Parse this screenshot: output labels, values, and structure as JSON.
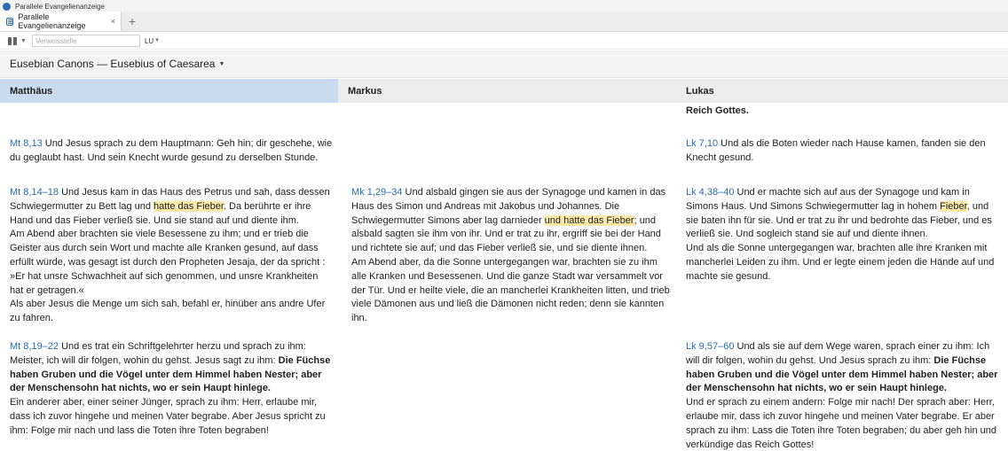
{
  "window": {
    "title": "Parallele Evangelienanzeige"
  },
  "tab": {
    "label": "Parallele Evangelienanzeige",
    "close": "×",
    "add": "+"
  },
  "toolbar": {
    "reference_placeholder": "Verweisstelle",
    "version": "LU"
  },
  "header": {
    "title": "Eusebian Canons — Eusebius of Caesarea"
  },
  "columns": [
    {
      "name": "Matthäus"
    },
    {
      "name": "Markus"
    },
    {
      "name": "Lukas"
    }
  ],
  "rows": [
    {
      "mt": {
        "ref": "",
        "text": ""
      },
      "mk": {
        "ref": "",
        "text": ""
      },
      "lk": {
        "ref": "",
        "bold": "Reich Gottes."
      }
    },
    {
      "mt": {
        "ref": "Mt 8,13",
        "text": " Und Jesus sprach zu dem Hauptmann: Geh hin; dir geschehe, wie du geglaubt hast. Und sein Knecht wurde gesund zu derselben Stunde."
      },
      "mk": {
        "ref": "",
        "text": ""
      },
      "lk": {
        "ref": "Lk 7,10",
        "text": " Und als die Boten wieder nach Hause kamen, fanden sie den Knecht gesund."
      }
    },
    {
      "mt": {
        "ref": "Mt 8,14–18",
        "t1": " Und Jesus kam in das Haus des Petrus und sah, dass dessen Schwiegermutter zu Bett lag und ",
        "h1": "hatte das Fieber",
        "t2": ". Da berührte er ihre Hand und das Fieber verließ sie. Und sie stand auf und diente ihm.",
        "p2": "Am Abend aber brachten sie viele Besessene zu ihm; und er trieb die Geister aus durch sein Wort und machte alle Kranken gesund, auf dass erfüllt würde, was gesagt ist durch den Propheten Jesaja, der da spricht : »Er hat unsre Schwachheit auf sich genommen, und unsre Krankheiten hat er getragen.«",
        "p3": "Als aber Jesus die Menge um sich sah, befahl er, hinüber ans andre Ufer zu fahren."
      },
      "mk": {
        "ref": "Mk 1,29–34",
        "t1": " Und alsbald gingen sie aus der Synagoge und kamen in das Haus des Simon und Andreas mit Jakobus und Johannes. Die Schwiegermutter Simons aber lag darnieder ",
        "h1": "und hatte das Fieber",
        "t2": "; und alsbald sagten sie ihm von ihr. Und er trat zu ihr, ergriff sie bei der Hand und richtete sie auf; und das Fieber verließ sie, und sie diente ihnen.",
        "p2": "Am Abend aber, da die Sonne untergegangen war, brachten sie zu ihm alle Kranken und Besessenen. Und die ganze Stadt war versammelt vor der Tür. Und er heilte viele, die an mancherlei Krankheiten litten, und trieb viele Dämonen aus und ließ die Dämonen nicht reden; denn sie kannten ihn."
      },
      "lk": {
        "ref": "Lk 4,38–40",
        "t1": " Und er machte sich auf aus der Synagoge und kam in Simons Haus. Und Simons Schwiegermutter lag in hohem ",
        "h1": "Fieber",
        "t2": ", und sie baten ihn für sie. Und er trat zu ihr und bedrohte das Fieber, und es verließ sie. Und sogleich stand sie auf und diente ihnen.",
        "p2": "Und als die Sonne untergegangen war, brachten alle ihre Kranken mit mancherlei Leiden zu ihm. Und er legte einem jeden die Hände auf und machte sie gesund."
      }
    },
    {
      "mt": {
        "ref": "Mt 8,19–22",
        "t1": " Und es trat ein Schriftgelehrter herzu und sprach zu ihm: Meister, ich will dir folgen, wohin du gehst. Jesus sagt zu ihm: ",
        "b1": "Die Füchse haben Gruben und die Vögel unter dem Himmel haben Nester; aber der Menschensohn hat nichts, wo er sein Haupt hinlege.",
        "p2": "Ein anderer aber, einer seiner Jünger, sprach zu ihm: Herr, erlaube mir, dass ich zuvor hingehe und meinen Vater begrabe. Aber Jesus spricht zu ihm: Folge mir nach und lass die Toten ihre Toten begraben!"
      },
      "mk": {
        "ref": "",
        "text": ""
      },
      "lk": {
        "ref": "Lk 9,57–60",
        "t1": " Und als sie auf dem Wege waren, sprach einer zu ihm: Ich will dir folgen, wohin du gehst. Und Jesus sprach zu ihm: ",
        "b1": "Die Füchse haben Gruben und die Vögel unter dem Himmel haben Nester; aber der Menschensohn hat nichts, wo er sein Haupt hinlege.",
        "p2": "Und er sprach zu einem andern: Folge mir nach! Der sprach aber: Herr, erlaube mir, dass ich zuvor hingehe und meinen Vater begrabe. Er aber sprach zu ihm: Lass die Toten ihre Toten begraben; du aber geh hin und verkündige das Reich Gottes!"
      }
    }
  ],
  "colors": {
    "reference": "#2b6cb0",
    "highlight": "#fbe9a8",
    "active_column": "#c9dbef"
  }
}
